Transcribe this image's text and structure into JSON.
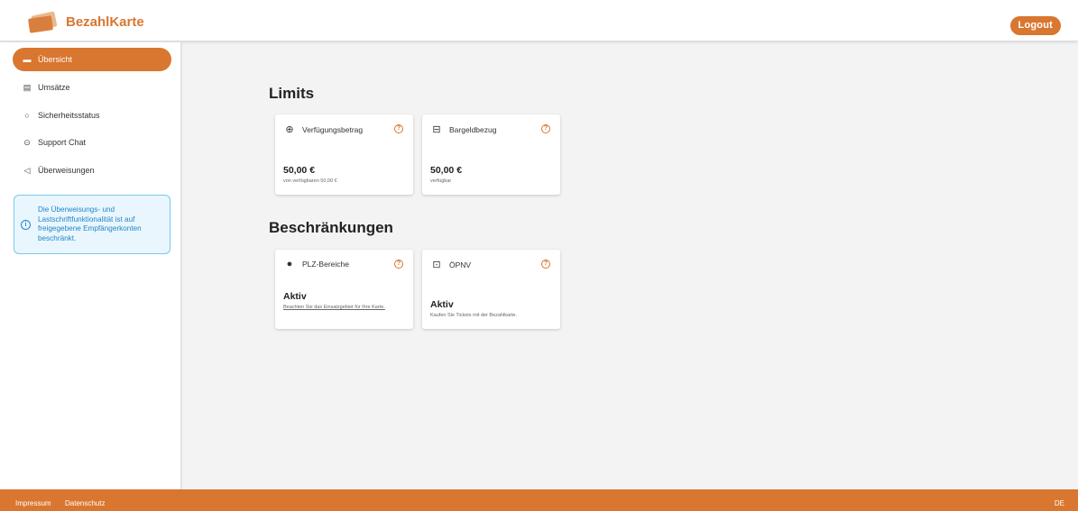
{
  "header": {
    "logo_text": "BezahlKarte",
    "logout_label": "Logout"
  },
  "sidebar": {
    "items": [
      {
        "label": "Übersicht",
        "icon": "card-icon"
      },
      {
        "label": "Umsätze",
        "icon": "receipt-icon"
      },
      {
        "label": "Sicherheitsstatus",
        "icon": "shield-icon"
      },
      {
        "label": "Support Chat",
        "icon": "help-icon"
      },
      {
        "label": "Überweisungen",
        "icon": "send-icon"
      }
    ],
    "info_text": "Die Überweisungs- und Lastschriftfunktionalität ist auf freigegebene Empfängerkonten beschränkt."
  },
  "limits": {
    "title": "Limits",
    "cards": [
      {
        "label": "Verfügungsbetrag",
        "icon": "coins-icon",
        "value": "50,00 €",
        "sub": "von verfügbaren 50,00 €"
      },
      {
        "label": "Bargeldbezug",
        "icon": "cash-icon",
        "value": "50,00 €",
        "sub": "verfügbar"
      }
    ]
  },
  "restrictions": {
    "title": "Beschränkungen",
    "cards": [
      {
        "label": "PLZ-Bereiche",
        "icon": "location-pin-icon",
        "value": "Aktiv",
        "sub": "Beachten Sie das Einsatzgebiet für Ihre Karte."
      },
      {
        "label": "ÖPNV",
        "icon": "bus-icon",
        "value": "Aktiv",
        "sub": "Kaufen Sie Tickets mit der Bezahlkarte."
      }
    ]
  },
  "footer": {
    "impressum": "Impressum",
    "datenschutz": "Datenschutz",
    "language": "DE"
  },
  "colors": {
    "accent": "#d9762f",
    "info": "#1e87c9"
  }
}
